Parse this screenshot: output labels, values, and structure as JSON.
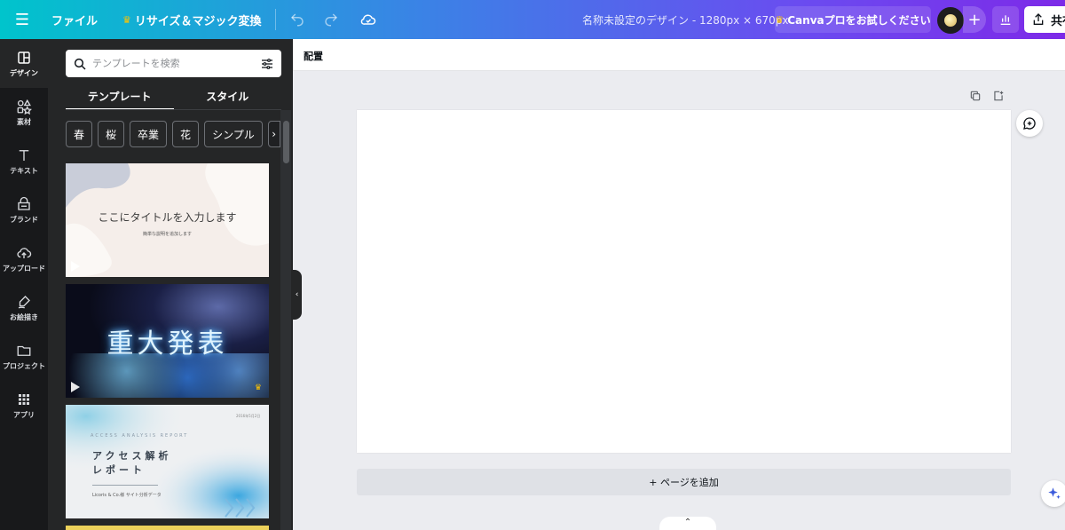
{
  "topbar": {
    "file_label": "ファイル",
    "resize_label": "リサイズ＆マジック変換",
    "title": "名称未設定のデザイン - 1280px × 670px",
    "pro_label": "Canvaプロをお試しください",
    "share_label": "共有"
  },
  "rail": {
    "items": [
      {
        "label": "デザイン",
        "icon": "layout-icon"
      },
      {
        "label": "素材",
        "icon": "shapes-icon"
      },
      {
        "label": "テキスト",
        "icon": "text-icon"
      },
      {
        "label": "ブランド",
        "icon": "brand-icon"
      },
      {
        "label": "アップロード",
        "icon": "cloud-upload-icon"
      },
      {
        "label": "お絵描き",
        "icon": "draw-icon"
      },
      {
        "label": "プロジェクト",
        "icon": "folder-icon"
      },
      {
        "label": "アプリ",
        "icon": "apps-grid-icon"
      }
    ]
  },
  "panel": {
    "search_placeholder": "テンプレートを検索",
    "tabs": [
      "テンプレート",
      "スタイル"
    ],
    "chips": [
      "春",
      "桜",
      "卒業",
      "花",
      "シンプル"
    ],
    "templates": {
      "t1_title": "ここにタイトルを入力します",
      "t1_sub": "簡単な説明を追加します",
      "t2_title": "重大発表",
      "t3_small": "ACCESS ANALYSIS REPORT",
      "t3_date": "2016年5月2日",
      "t3_line1": "アクセス解析",
      "t3_line2": "レポート",
      "t3_foot": "Licoris & Co.様 サイト分析データ"
    }
  },
  "canvas": {
    "arrange_label": "配置",
    "add_page_label": "+ ページを追加"
  },
  "colors": {
    "topbar_start": "#00c4cc",
    "topbar_end": "#7d2ae8",
    "rail_bg": "#18191b",
    "panel_bg": "#252627",
    "canvas_bg": "#ebecf0",
    "crown": "#ffc400"
  }
}
